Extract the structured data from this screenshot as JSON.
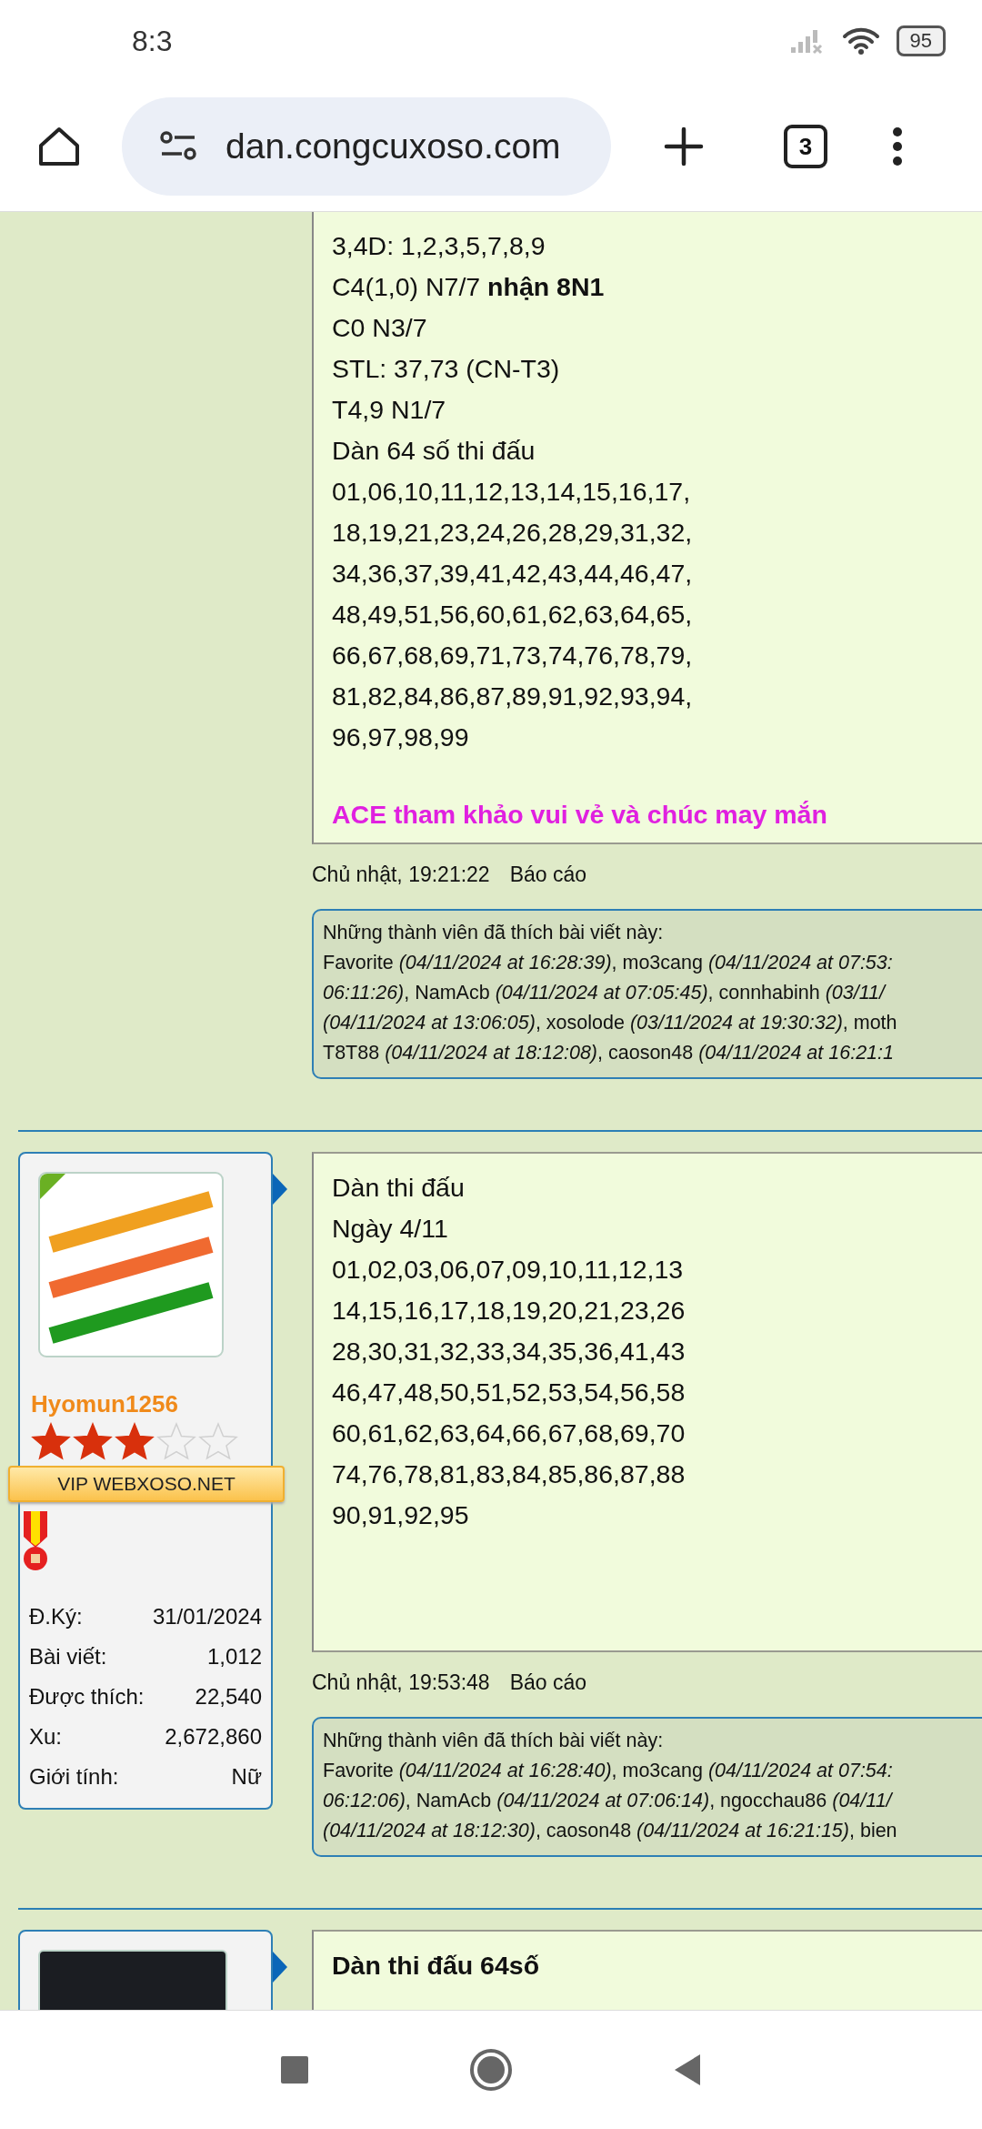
{
  "status_bar": {
    "time": "8:3",
    "battery": "95"
  },
  "browser": {
    "url": "dan.congcuxoso.com",
    "tab_count": "3"
  },
  "posts": [
    {
      "lines": [
        {
          "kind": "text",
          "text": "3,4D: 1,2,3,5,7,8,9"
        },
        {
          "kind": "text",
          "text": "C4(1,0) N7/7 **nhận 8N1**"
        },
        {
          "kind": "text",
          "text": "C0 N3/7"
        },
        {
          "kind": "text",
          "text": "STL: 37,73 (CN-T3)"
        },
        {
          "kind": "text",
          "text": "T4,9 N1/7"
        },
        {
          "kind": "text",
          "text": "Dàn 64 số thi đấu"
        },
        {
          "kind": "text",
          "text": "01,06,10,11,12,13,14,15,16,17,"
        },
        {
          "kind": "text",
          "text": "18,19,21,23,24,26,28,29,31,32,"
        },
        {
          "kind": "text",
          "text": "34,36,37,39,41,42,43,44,46,47,"
        },
        {
          "kind": "text",
          "text": "48,49,51,56,60,61,62,63,64,65,"
        },
        {
          "kind": "text",
          "text": "66,67,68,69,71,73,74,76,78,79,"
        },
        {
          "kind": "text",
          "text": "81,82,84,86,87,89,91,92,93,94,"
        },
        {
          "kind": "text",
          "text": "96,97,98,99"
        },
        {
          "kind": "closing",
          "text": "ACE tham khảo vui vẻ và chúc may mắn"
        }
      ],
      "date": "Chủ nhật, 19:21:22",
      "report": "Báo cáo",
      "likes": {
        "title": "Những thành viên đã thích bài viết này:",
        "lines": [
          "Favorite *(04/11/2024 at 16:28:39)*, mo3cang *(04/11/2024 at 07:53:*",
          "*06:11:26)*, NamAcb *(04/11/2024 at 07:05:45)*, connhabinh *(03/11/*",
          "*(04/11/2024 at 13:06:05)*, xosolode *(03/11/2024 at 19:30:32)*, moth",
          "T8T88 *(04/11/2024 at 18:12:08)*, caoson48 *(04/11/2024 at 16:21:1*"
        ]
      }
    },
    {
      "author": {
        "avatar": {
          "kind": "logo"
        },
        "name": "Hyomun1256",
        "stars": 3,
        "rank": "VIP WEBXOSO.NET",
        "medal": true,
        "stats": [
          {
            "label": "Đ.Ký:",
            "value": "31/01/2024"
          },
          {
            "label": "Bài viết:",
            "value": "1,012"
          },
          {
            "label": "Được thích:",
            "value": "22,540"
          },
          {
            "label": "Xu:",
            "value": "2,672,860"
          },
          {
            "label": "Giới tính:",
            "value": "Nữ"
          }
        ]
      },
      "lines": [
        {
          "kind": "text",
          "text": "Dàn thi đấu"
        },
        {
          "kind": "text",
          "text": "Ngày 4/11"
        },
        {
          "kind": "text",
          "text": "01,02,03,06,07,09,10,11,12,13"
        },
        {
          "kind": "text",
          "text": "14,15,16,17,18,19,20,21,23,26"
        },
        {
          "kind": "text",
          "text": "28,30,31,32,33,34,35,36,41,43"
        },
        {
          "kind": "text",
          "text": "46,47,48,50,51,52,53,54,56,58"
        },
        {
          "kind": "text",
          "text": "60,61,62,63,64,66,67,68,69,70"
        },
        {
          "kind": "text",
          "text": "74,76,78,81,83,84,85,86,87,88"
        },
        {
          "kind": "text",
          "text": "90,91,92,95"
        }
      ],
      "date": "Chủ nhật, 19:53:48",
      "report": "Báo cáo",
      "likes": {
        "title": "Những thành viên đã thích bài viết này:",
        "lines": [
          "Favorite *(04/11/2024 at 16:28:40)*, mo3cang *(04/11/2024 at 07:54:*",
          "*06:12:06)*, NamAcb *(04/11/2024 at 07:06:14)*, ngocchau86 *(04/11/*",
          "*(04/11/2024 at 18:12:30)*, caoson48 *(04/11/2024 at 16:21:15)*, bien"
        ]
      }
    },
    {
      "author": {
        "avatar": {
          "kind": "photo"
        }
      },
      "lines": [
        {
          "kind": "heading",
          "text": "Dàn thi đấu 64số"
        }
      ]
    }
  ]
}
